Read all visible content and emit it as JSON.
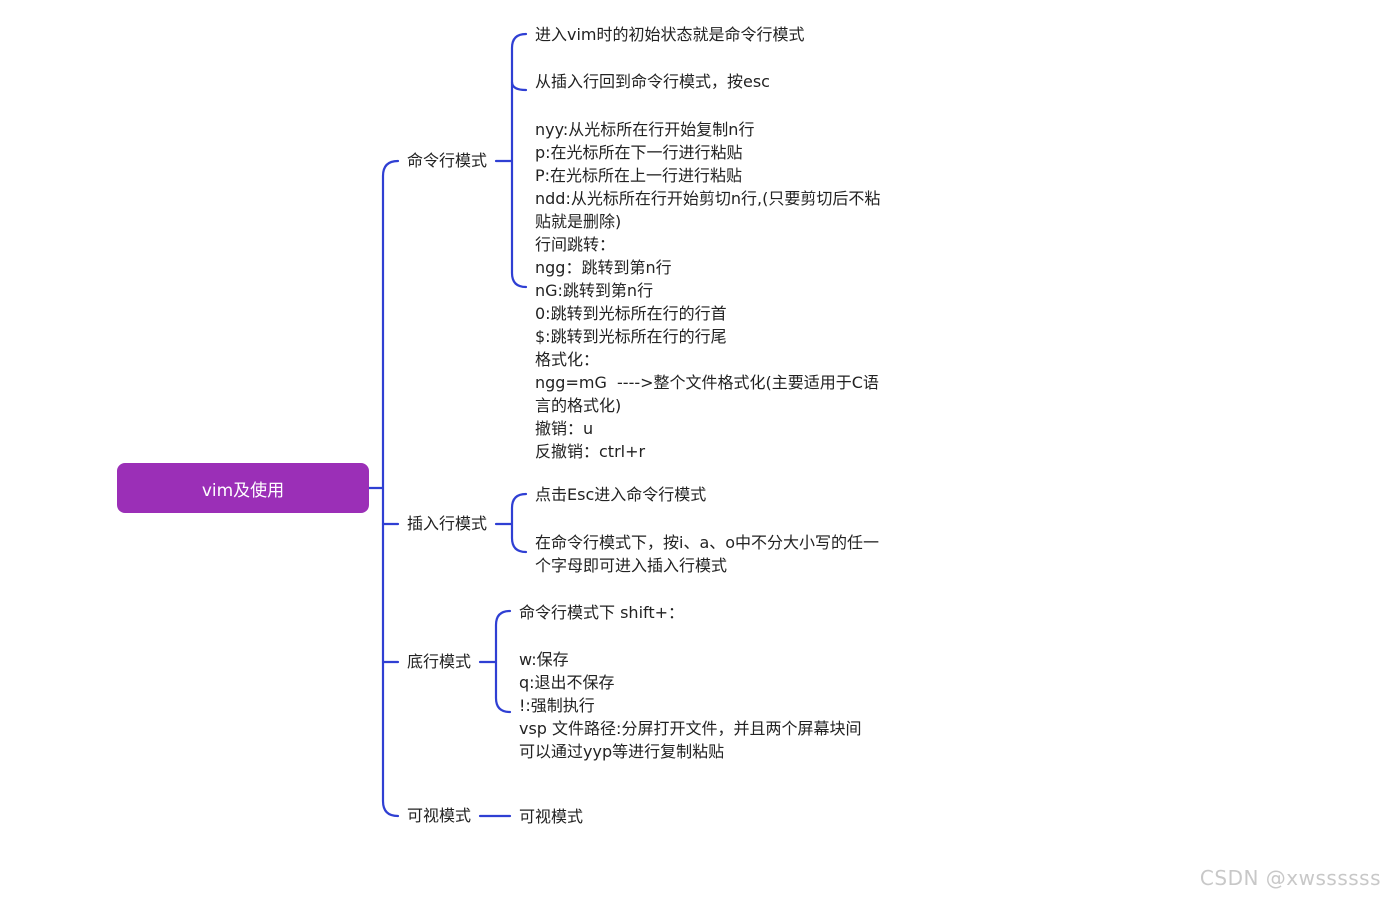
{
  "root": {
    "label": "vim及使用"
  },
  "branches": [
    {
      "label": "命令行模式",
      "children": [
        "进入vim时的初始状态就是命令行模式",
        "从插入行回到命令行模式，按esc",
        "nyy:从光标所在行开始复制n行\np:在光标所在下一行进行粘贴\nP:在光标所在上一行进行粘贴\nndd:从光标所在行开始剪切n行,(只要剪切后不粘\n贴就是删除)\n行间跳转：\nngg：跳转到第n行\nnG:跳转到第n行\n0:跳转到光标所在行的行首\n$:跳转到光标所在行的行尾\n格式化：\nngg=mG  ---->整个文件格式化(主要适用于C语\n言的格式化)\n撤销：u\n反撤销：ctrl+r"
      ]
    },
    {
      "label": "插入行模式",
      "children": [
        "点击Esc进入命令行模式",
        "在命令行模式下，按i、a、o中不分大小写的任一\n个字母即可进入插入行模式"
      ]
    },
    {
      "label": "底行模式",
      "children": [
        "命令行模式下 shift+：",
        "w:保存\nq:退出不保存\n!:强制执行\nvsp 文件路径:分屏打开文件，并且两个屏幕块间\n可以通过yyp等进行复制粘贴"
      ]
    },
    {
      "label": "可视模式",
      "children": [
        "可视模式"
      ]
    }
  ],
  "watermark": "CSDN @xwssssss",
  "colors": {
    "root_fill": "#9b2fb7",
    "connector": "#2f3fd3"
  }
}
